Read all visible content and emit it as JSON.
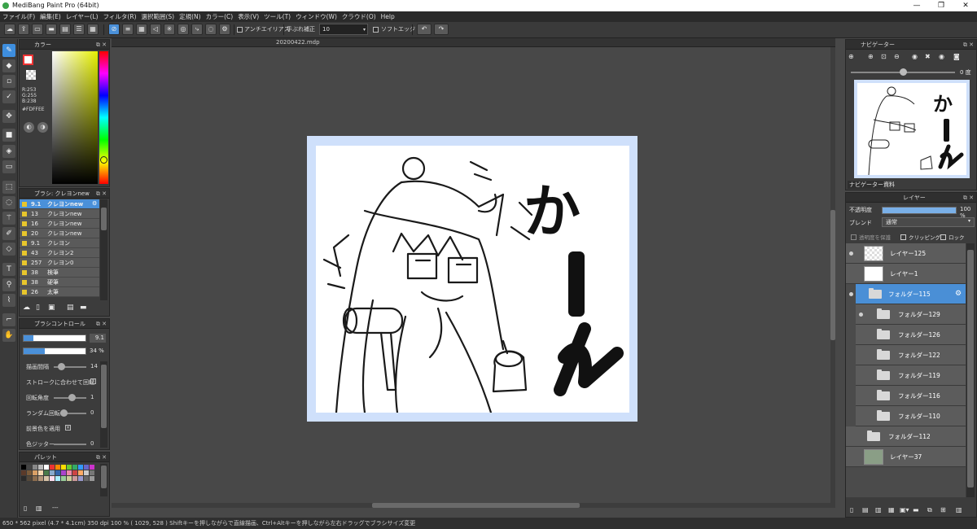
{
  "window": {
    "title": "MediBang Paint Pro (64bit)",
    "minimize": "—",
    "maximize": "❐",
    "close": "✕"
  },
  "menu": [
    "ファイル(F)",
    "編集(E)",
    "レイヤー(L)",
    "フィルタ(R)",
    "選択範囲(S)",
    "定規(N)",
    "カラー(C)",
    "表示(V)",
    "ツール(T)",
    "ウィンドウ(W)",
    "クラウド(O)",
    "Help"
  ],
  "toolbar": {
    "antialias_label": "アンチエイリアス",
    "stabilizer_label": "手ぶれ補正",
    "stabilizer_value": "10",
    "soft_edge_label": "ソフトエッジ"
  },
  "document": {
    "tab": "20200422.mdp"
  },
  "color_panel": {
    "title": "カラー",
    "r": "R:253",
    "g": "G:255",
    "b": "B:238",
    "hex": "#FDFFEE"
  },
  "brush_panel": {
    "title": "ブラシ: クレヨンnew",
    "items": [
      {
        "size": "9.1",
        "name": "クレヨンnew"
      },
      {
        "size": "13",
        "name": "クレヨンnew"
      },
      {
        "size": "16",
        "name": "クレヨンnew"
      },
      {
        "size": "20",
        "name": "クレヨンnew"
      },
      {
        "size": "9.1",
        "name": "クレヨン"
      },
      {
        "size": "43",
        "name": "クレヨン2"
      },
      {
        "size": "257",
        "name": "クレヨン0"
      },
      {
        "size": "38",
        "name": "検筆"
      },
      {
        "size": "38",
        "name": "硬筆"
      },
      {
        "size": "26",
        "name": "太筆"
      }
    ]
  },
  "brush_control": {
    "title": "ブラシコントロール",
    "size_value": "9.1",
    "opacity_value": "34 %",
    "opacity_level": 0.34,
    "spacing_label": "描画間隔",
    "spacing_value": "14",
    "rotate_stroke_label": "ストロークに合わせて回転",
    "angle_label": "回転角度",
    "angle_value": "1",
    "random_rotate_label": "ランダム回転",
    "random_rotate_value": "0",
    "apply_fg_label": "前景色を適用",
    "jitter_label": "色ジッター",
    "jitter_value": "0"
  },
  "palette": {
    "title": "パレット",
    "footer": "---"
  },
  "navigator": {
    "title": "ナビゲーター",
    "angle": "0 度",
    "tab_nav": "ナビゲーター",
    "tab_ref": "資料"
  },
  "layers": {
    "title": "レイヤー",
    "opacity_label": "不透明度",
    "opacity_value": "100 %",
    "opacity_level": 1.0,
    "blend_label": "ブレンド",
    "blend_value": "通常",
    "protect_label": "透明度を保護",
    "clip_label": "クリッピング",
    "lock_label": "ロック",
    "items": [
      {
        "name": "レイヤー125",
        "kind": "layer"
      },
      {
        "name": "レイヤー1",
        "kind": "layer"
      },
      {
        "name": "フォルダー115",
        "kind": "folder"
      },
      {
        "name": "フォルダー129",
        "kind": "folder"
      },
      {
        "name": "フォルダー126",
        "kind": "folder"
      },
      {
        "name": "フォルダー122",
        "kind": "folder"
      },
      {
        "name": "フォルダー119",
        "kind": "folder"
      },
      {
        "name": "フォルダー116",
        "kind": "folder"
      },
      {
        "name": "フォルダー110",
        "kind": "folder"
      },
      {
        "name": "フォルダー112",
        "kind": "folder"
      },
      {
        "name": "レイヤー37",
        "kind": "layer"
      }
    ]
  },
  "status": {
    "text": "650 * 562 pixel   (4.7 * 4.1cm)   350 dpi   100 %   ( 1029, 528 )   Shiftキーを押しながらで直線描画、Ctrl+Altキーを押しながら左右ドラッグでブラシサイズ変更"
  },
  "artwork": {
    "text": "かーん"
  }
}
